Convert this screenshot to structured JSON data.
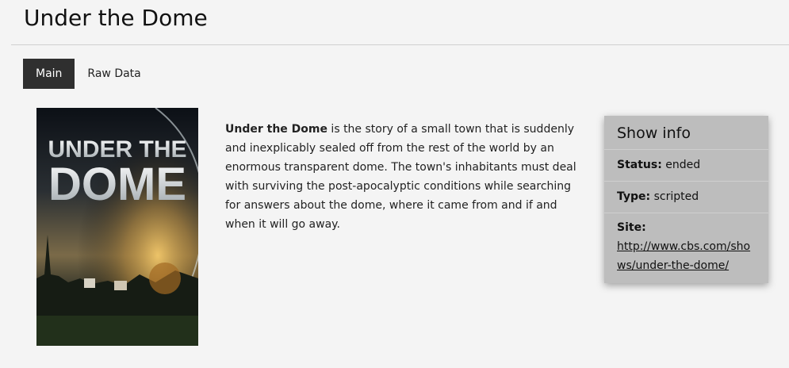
{
  "page": {
    "title": "Under the Dome"
  },
  "tabs": [
    {
      "label": "Main",
      "active": true
    },
    {
      "label": "Raw Data",
      "active": false
    }
  ],
  "poster": {
    "line1": "UNDER THE",
    "line2": "DOME"
  },
  "summary": {
    "name": "Under the Dome",
    "text": " is the story of a small town that is suddenly and inexplicably sealed off from the rest of the world by an enormous transparent dome. The town's inhabitants must deal with surviving the post-apocalyptic conditions while searching for answers about the dome, where it came from and if and when it will go away."
  },
  "show_info": {
    "title": "Show info",
    "status_label": "Status:",
    "status_value": "ended",
    "type_label": "Type:",
    "type_value": "scripted",
    "site_label": "Site:",
    "site_url": "http://www.cbs.com/shows/under-the-dome/"
  }
}
